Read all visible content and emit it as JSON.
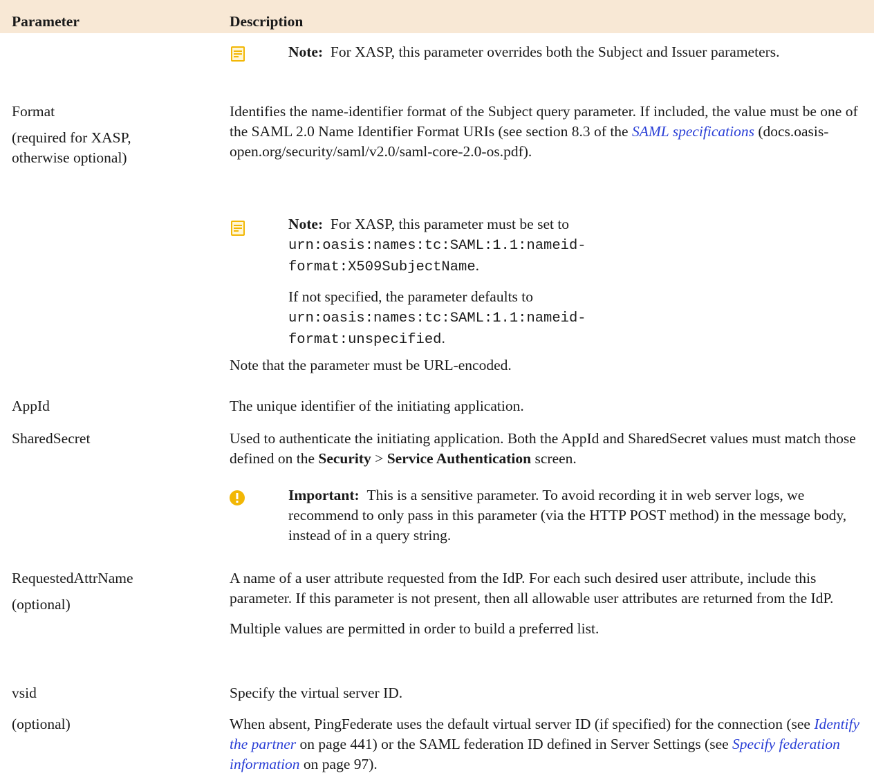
{
  "header": {
    "col1": "Parameter",
    "col2": "Description"
  },
  "rows": {
    "overrides": {
      "note_label": "Note:",
      "note_text": "For XASP, this parameter overrides both the Subject and Issuer parameters."
    },
    "format": {
      "name": "Format",
      "qualifier": "(required for XASP, otherwise optional)",
      "desc_part1": "Identifies the name-identifier format of the Subject query parameter. If included, the value must be one of the SAML 2.0 Name Identifier Format URIs (see section 8.3 of the ",
      "desc_link": "SAML specifications",
      "desc_part2": " (docs.oasis-open.org/security/saml/v2.0/saml-core-2.0-os.pdf).",
      "note_label": "Note:",
      "note_text": "For XASP, this parameter must be set to",
      "note_code1": "urn:oasis:names:tc:SAML:1.1:nameid-format:X509SubjectName",
      "note_dot1": ".",
      "note2_text": "If not specified, the parameter defaults to",
      "note_code2": "urn:oasis:names:tc:SAML:1.1:nameid-format:unspecified",
      "note_dot2": ".",
      "footer": "Note that the parameter must be URL-encoded."
    },
    "appid": {
      "name": "AppId",
      "desc": "The unique identifier of the initiating application."
    },
    "sharedsecret": {
      "name": "SharedSecret",
      "desc_part1": "Used to authenticate the initiating application. Both the AppId and SharedSecret values must match those defined on the ",
      "bold1": "Security",
      "sep": " > ",
      "bold2": "Service Authentication",
      "desc_part2": " screen.",
      "important_label": "Important:",
      "important_text": "This is a sensitive parameter. To avoid recording it in web server logs, we recommend to only pass in this parameter (via the HTTP POST method) in the message body, instead of in a query string."
    },
    "requestedattr": {
      "name": "RequestedAttrName",
      "qualifier": "(optional)",
      "desc": "A name of a user attribute requested from the IdP. For each such desired user attribute, include this parameter. If this parameter is not present, then all allowable user attributes are returned from the IdP.",
      "desc2": "Multiple values are permitted in order to build a preferred list."
    },
    "vsid": {
      "name": "vsid",
      "qualifier": "(optional)",
      "desc": "Specify the virtual server ID.",
      "desc2_part1": "When absent, PingFederate uses the default virtual server ID (if specified) for the connection (see ",
      "link1": "Identify the partner",
      "desc2_part2": " on page 441) or the SAML federation ID defined in Server Settings (see ",
      "link2": "Specify federation information",
      "desc2_part3": " on page 97)."
    }
  },
  "colors": {
    "header_bg": "#f8e8d5",
    "link": "#2a3fd6",
    "note_icon": "#f2b705",
    "important_icon": "#f2b705"
  }
}
